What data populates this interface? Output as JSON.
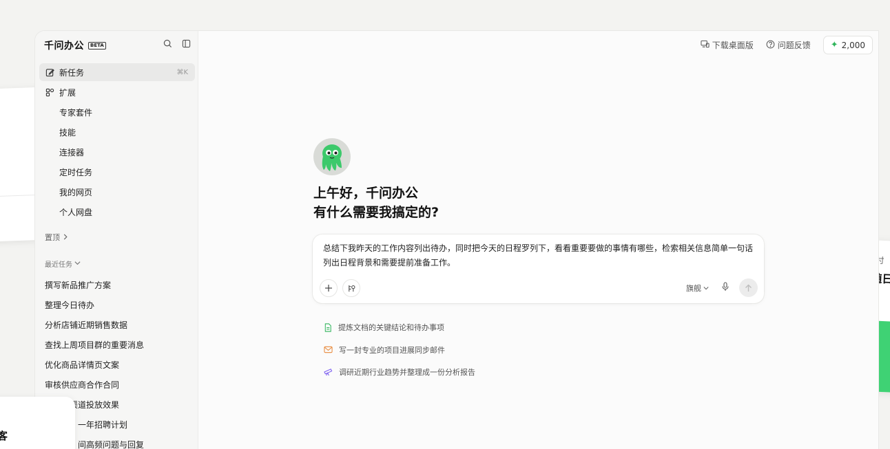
{
  "app": {
    "name": "千问办公",
    "badge": "BETA"
  },
  "sidebar": {
    "items": [
      {
        "label": "新任务",
        "shortcut": "⌘K",
        "icon": "edit-icon"
      },
      {
        "label": "扩展",
        "icon": "extensions-icon"
      },
      {
        "label": "专家套件"
      },
      {
        "label": "技能"
      },
      {
        "label": "连接器"
      },
      {
        "label": "定时任务"
      },
      {
        "label": "我的网页"
      },
      {
        "label": "个人网盘"
      }
    ],
    "pinned_label": "置顶",
    "recent_label": "最近任务",
    "recent_tasks": [
      "撰写新品推广方案",
      "整理今日待办",
      "分析店铺近期销售数据",
      "查找上周项目群的重要消息",
      "优化商品详情页文案",
      "审核供应商合作合同",
      "计算各渠道投放效果",
      "一年招聘计划",
      "间高频问题与回复"
    ]
  },
  "topbar": {
    "download_label": "下载桌面版",
    "feedback_label": "问题反馈",
    "credits": "2,000"
  },
  "hero": {
    "greeting_line1": "上午好，千问办公",
    "greeting_line2": "有什么需要我搞定的?"
  },
  "composer": {
    "text": "总结下我昨天的工作内容列出待办，同时把今天的日程罗列下，看看重要要做的事情有哪些，检索相关信息简单一句话列出日程背景和需要提前准备工作。",
    "model_label": "旗舰"
  },
  "suggestions": [
    {
      "label": "提炼文档的关键结论和待办事项",
      "icon": "document-icon",
      "color": "#2fb45a"
    },
    {
      "label": "写一封专业的项目进展同步邮件",
      "icon": "mail-icon",
      "color": "#e8883a"
    },
    {
      "label": "调研近期行业趋势并整理成一份分析报告",
      "icon": "telescope-icon",
      "color": "#7a5cf0"
    }
  ],
  "floating_cards": {
    "right_title": "文件交付",
    "right_subtitle": "产物随日",
    "left_bottom_text": "客"
  }
}
